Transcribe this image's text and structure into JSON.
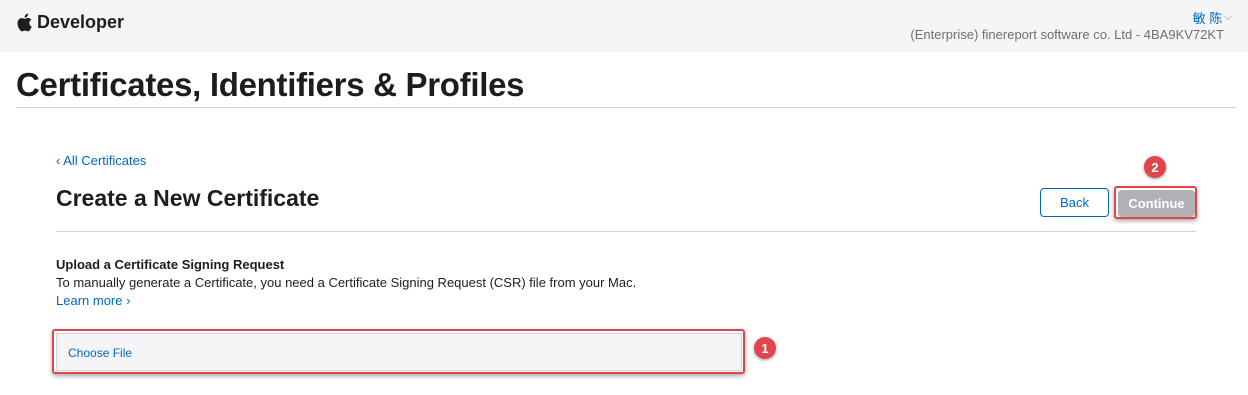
{
  "header": {
    "brand": "Developer",
    "user": "敏 陈",
    "team": "(Enterprise) finereport software co. Ltd - 4BA9KV72KT"
  },
  "page": {
    "title": "Certificates, Identifiers & Profiles"
  },
  "section": {
    "back_link": "‹ All Certificates",
    "title": "Create a New Certificate",
    "back_button": "Back",
    "continue_button": "Continue"
  },
  "upload": {
    "heading": "Upload a Certificate Signing Request",
    "description": "To manually generate a Certificate, you need a Certificate Signing Request (CSR) file from your Mac.",
    "learn_more": "Learn more ›",
    "choose_file": "Choose File"
  },
  "annotations": {
    "step1": "1",
    "step2": "2",
    "highlight_color": "#e0454a"
  },
  "icons": {
    "brand": "apple-logo-icon",
    "user_menu": "chevron-down-icon"
  },
  "colors": {
    "link": "#0066cc",
    "disabled_button": "#b1b1b6"
  }
}
